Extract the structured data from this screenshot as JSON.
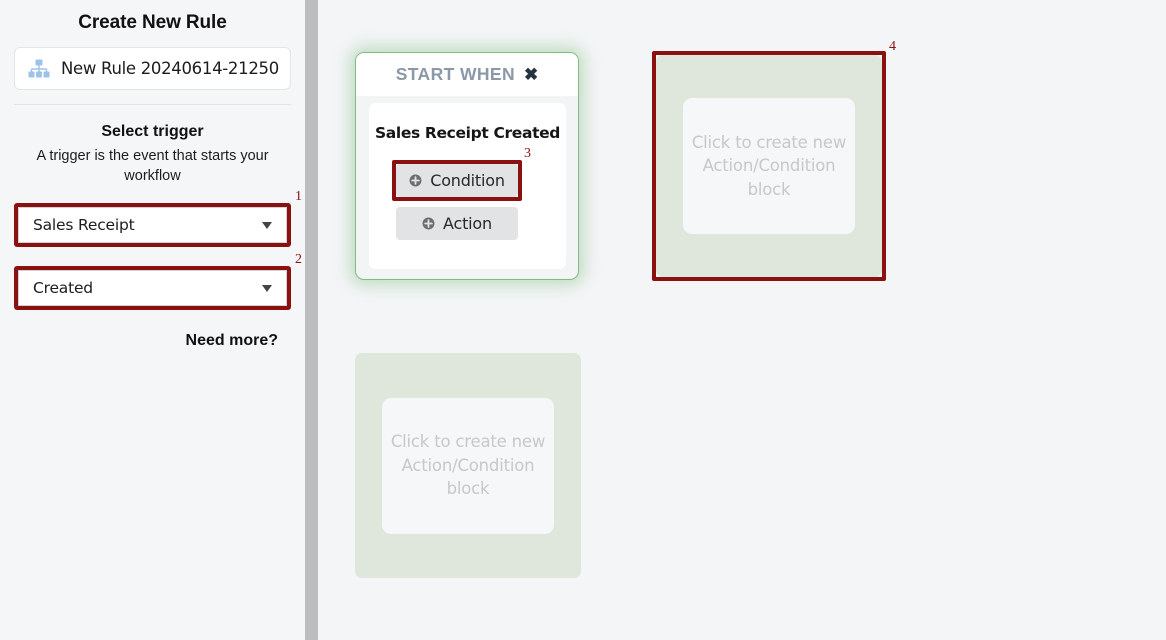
{
  "sidebar": {
    "title": "Create New Rule",
    "rule_name": {
      "icon": "sitemap-icon",
      "value": "New Rule 20240614-21250"
    },
    "trigger_section": {
      "heading": "Select trigger",
      "description": "A trigger is the event that starts your workflow",
      "object_select": {
        "value": "Sales Receipt",
        "caret_icon": "caret-down-icon",
        "annotation": "1"
      },
      "event_select": {
        "value": "Created",
        "caret_icon": "caret-down-icon",
        "annotation": "2"
      },
      "need_more_label": "Need more?"
    }
  },
  "canvas": {
    "start_card": {
      "header_label": "START WHEN",
      "close_icon": "close-x-icon",
      "trigger_title": "Sales Receipt Created",
      "condition_button": {
        "label": "Condition",
        "icon": "plus-circle-icon",
        "annotation": "3"
      },
      "action_button": {
        "label": "Action",
        "icon": "plus-circle-icon"
      },
      "accent_color": "#83bc83"
    },
    "dropzone_right": {
      "placeholder": "Click to create new Action/Condition block",
      "annotation": "4"
    },
    "dropzone_bottom": {
      "placeholder": "Click to create new Action/Condition block"
    }
  },
  "colors": {
    "annotation": "#8b1111",
    "dropzone_bg": "#dfe7dd",
    "canvas_bg": "#f4f5f7"
  }
}
